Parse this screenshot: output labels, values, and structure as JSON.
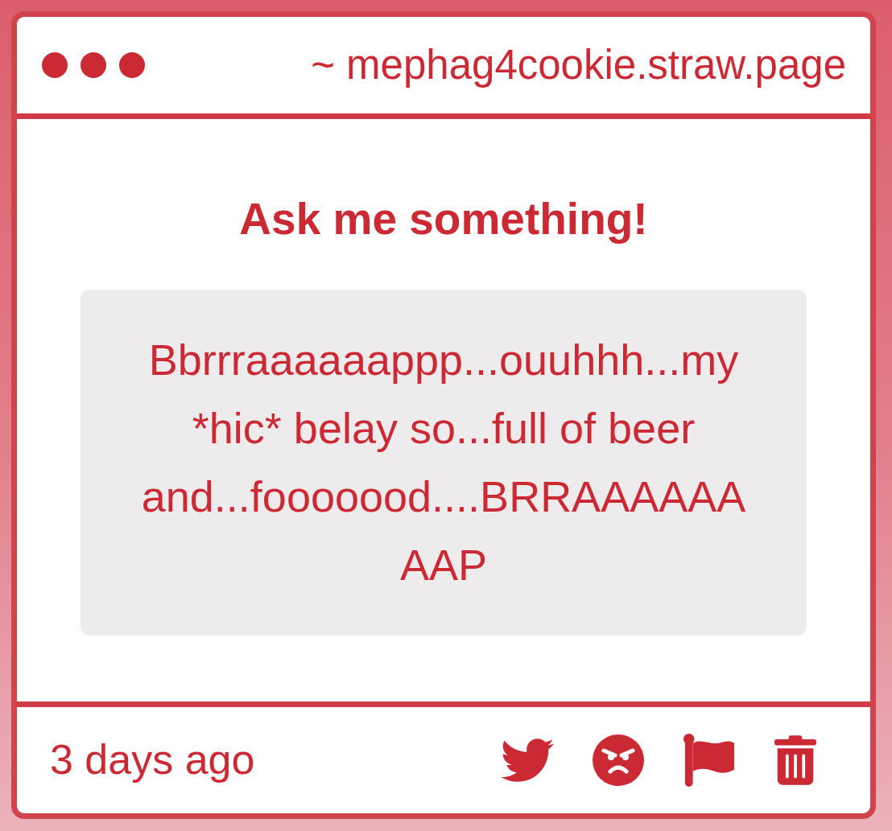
{
  "window": {
    "title": "~ mephag4cookie.straw.page"
  },
  "prompt": {
    "title": "Ask me something!"
  },
  "question": {
    "text": "Bbrrraaaaaappp...ouuhhh...my *hic* belay so...full of beer and...fooooood....BRRAAAAAAAAP"
  },
  "footer": {
    "time": "3 days ago"
  }
}
